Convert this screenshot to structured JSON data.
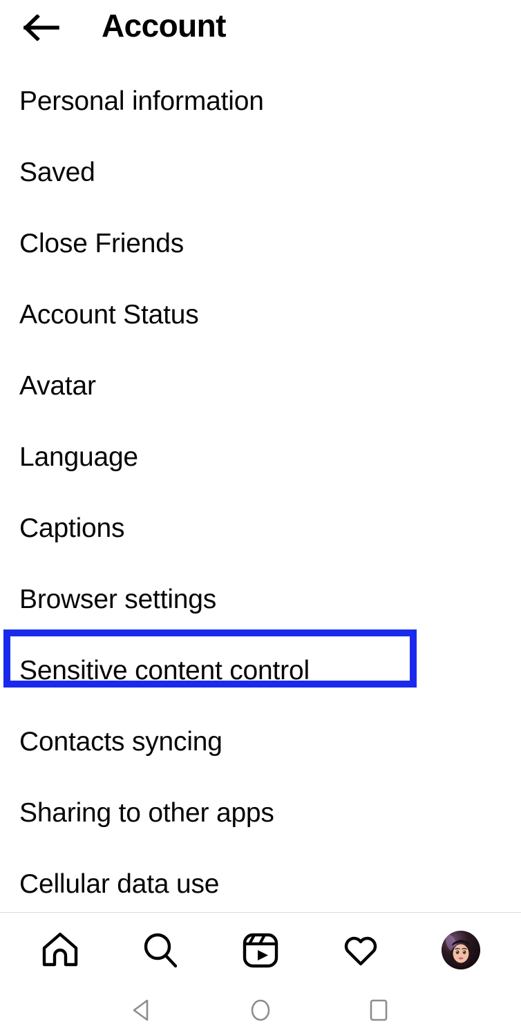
{
  "header": {
    "title": "Account",
    "back_icon": "arrow-left-icon"
  },
  "menu": {
    "items": [
      {
        "label": "Personal information",
        "highlighted": false
      },
      {
        "label": "Saved",
        "highlighted": false
      },
      {
        "label": "Close Friends",
        "highlighted": false
      },
      {
        "label": "Account Status",
        "highlighted": false
      },
      {
        "label": "Avatar",
        "highlighted": false
      },
      {
        "label": "Language",
        "highlighted": false
      },
      {
        "label": "Captions",
        "highlighted": false
      },
      {
        "label": "Browser settings",
        "highlighted": false
      },
      {
        "label": "Sensitive content control",
        "highlighted": true
      },
      {
        "label": "Contacts syncing",
        "highlighted": false
      },
      {
        "label": "Sharing to other apps",
        "highlighted": false
      },
      {
        "label": "Cellular data use",
        "highlighted": false
      }
    ]
  },
  "highlight": {
    "color": "#1a2aec",
    "target_label": "Sensitive content control"
  },
  "tabbar": {
    "items": [
      {
        "name": "home-icon",
        "label": "Home"
      },
      {
        "name": "search-icon",
        "label": "Search"
      },
      {
        "name": "reels-icon",
        "label": "Reels"
      },
      {
        "name": "heart-icon",
        "label": "Activity"
      },
      {
        "name": "avatar",
        "label": "Profile"
      }
    ]
  },
  "system_nav": {
    "items": [
      {
        "name": "android-back-icon",
        "label": "Back"
      },
      {
        "name": "android-home-icon",
        "label": "Home"
      },
      {
        "name": "android-recents-icon",
        "label": "Recents"
      }
    ],
    "color": "#8d8d8d"
  },
  "colors": {
    "background": "#ffffff",
    "text": "#050505",
    "divider": "#dbdbdb",
    "accent": "#1a2aec"
  }
}
